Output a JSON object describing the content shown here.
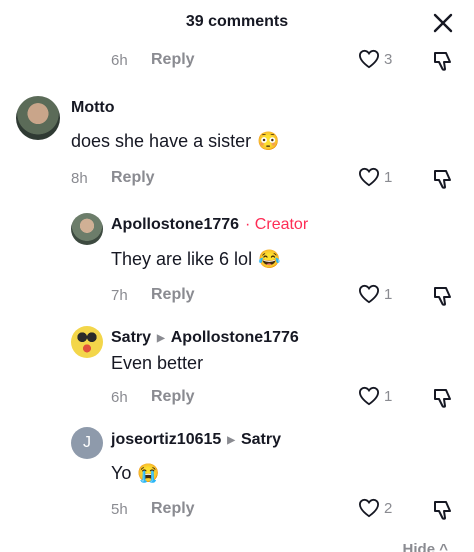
{
  "header": {
    "title": "39 comments",
    "close_icon": "close-icon"
  },
  "first_meta": {
    "time": "6h",
    "reply": "Reply",
    "likes": "3"
  },
  "comments": [
    {
      "user": "Motto",
      "text": "does she have a sister",
      "emoji": "😳",
      "time": "8h",
      "reply": "Reply",
      "likes": "1"
    },
    {
      "user": "Apollostone1776",
      "creator": "· Creator",
      "text": "They are like 6 lol",
      "emoji": "😂",
      "time": "7h",
      "reply": "Reply",
      "likes": "1"
    },
    {
      "user": "Satry",
      "reply_to": "Apollostone1776",
      "text": "Even better",
      "time": "6h",
      "reply": "Reply",
      "likes": "1"
    },
    {
      "user": "joseortiz10615",
      "reply_to": "Satry",
      "avatar_letter": "J",
      "text": "Yo",
      "emoji": "😭",
      "time": "5h",
      "reply": "Reply",
      "likes": "2"
    }
  ],
  "footer": {
    "hide": "Hide"
  },
  "colors": {
    "accent": "#fe2c55",
    "muted": "#8a8b91",
    "text": "#161823"
  }
}
